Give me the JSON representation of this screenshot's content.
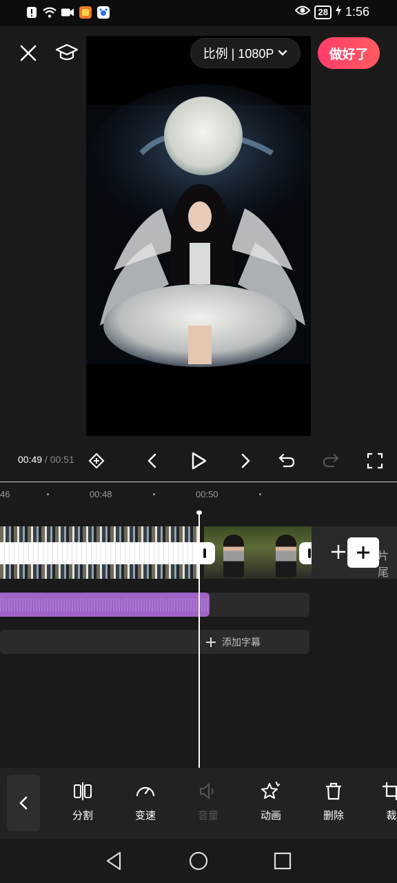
{
  "status_bar": {
    "time": "1:56",
    "battery": "28"
  },
  "header": {
    "ratio_label": "比例 | 1080P",
    "done_label": "做好了"
  },
  "player": {
    "current_time": "00:49",
    "separator": " / ",
    "total_time": "00:51"
  },
  "ruler": {
    "ticks": [
      "46",
      "00:48",
      "00:50"
    ]
  },
  "timeline": {
    "tail_label": "片尾",
    "add_subtitle_label": "添加字幕"
  },
  "toolbar": {
    "items": [
      {
        "label": "分割",
        "icon": "split-icon"
      },
      {
        "label": "变速",
        "icon": "speed-icon"
      },
      {
        "label": "音量",
        "icon": "volume-icon"
      },
      {
        "label": "动画",
        "icon": "animation-icon"
      },
      {
        "label": "删除",
        "icon": "delete-icon"
      },
      {
        "label": "裁",
        "icon": "crop-icon"
      }
    ]
  }
}
